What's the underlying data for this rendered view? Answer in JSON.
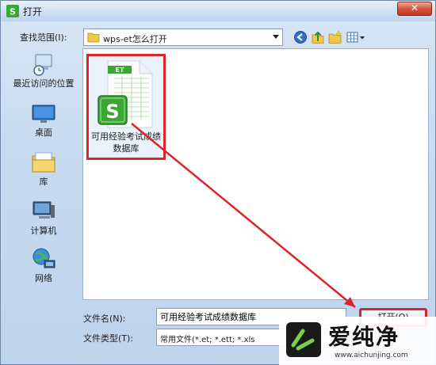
{
  "window": {
    "title": "打开",
    "close_glyph": "✕"
  },
  "toolbar": {
    "look_in_label": "查找范围(I):",
    "look_in_value": "wps-et怎么打开",
    "icons": [
      "back-icon",
      "up-folder-icon",
      "new-folder-icon",
      "view-menu-icon"
    ]
  },
  "places": [
    {
      "label": "最近访问的位置",
      "icon": "recent-places-icon"
    },
    {
      "label": "桌面",
      "icon": "desktop-icon"
    },
    {
      "label": "库",
      "icon": "library-icon"
    },
    {
      "label": "计算机",
      "icon": "computer-icon"
    },
    {
      "label": "网络",
      "icon": "network-icon"
    }
  ],
  "files": [
    {
      "name_line1": "可用经验考试成绩",
      "name_line2": "数据库",
      "icon_badge": "ET",
      "icon_letter": "S"
    }
  ],
  "filename": {
    "label": "文件名(N):",
    "value": "可用经验考试成绩数据库"
  },
  "filetype": {
    "label": "文件类型(T):",
    "value": "常用文件(*.et; *.ett; *.xls"
  },
  "buttons": {
    "open_label": "打开(O)"
  },
  "watermark": {
    "text": "爱纯净",
    "url": "www.aichunjing.com"
  },
  "colors": {
    "highlight": "#d8262b",
    "wps_green": "#3aa835"
  }
}
